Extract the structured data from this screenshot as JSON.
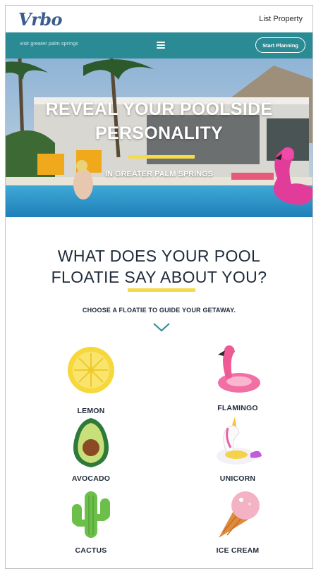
{
  "header": {
    "logo": "Vrbo",
    "list_property": "List Property"
  },
  "navbar": {
    "brand": "visit greater palm springs",
    "menu_icon": "hamburger-icon",
    "cta": "Start Planning"
  },
  "hero": {
    "title_line1": "REVEAL YOUR POOLSIDE",
    "title_line2": "PERSONALITY",
    "subtitle": "IN GREATER PALM SPRINGS"
  },
  "main": {
    "question_line1": "WHAT DOES YOUR POOL",
    "question_line2": "FLOATIE SAY ABOUT YOU?",
    "instruction": "CHOOSE A FLOATIE TO GUIDE YOUR GETAWAY.",
    "chevron_icon": "chevron-down-icon",
    "floaties": [
      {
        "label": "LEMON",
        "icon": "lemon-float-icon"
      },
      {
        "label": "FLAMINGO",
        "icon": "flamingo-float-icon"
      },
      {
        "label": "AVOCADO",
        "icon": "avocado-float-icon"
      },
      {
        "label": "UNICORN",
        "icon": "unicorn-float-icon"
      },
      {
        "label": "CACTUS",
        "icon": "cactus-float-icon"
      },
      {
        "label": "ICE CREAM",
        "icon": "ice-cream-float-icon"
      }
    ]
  },
  "colors": {
    "nav_teal": "#2a8b94",
    "accent_yellow": "#f4db4a",
    "text_dark": "#1f2a3a",
    "logo_blue": "#3a5d8f"
  }
}
